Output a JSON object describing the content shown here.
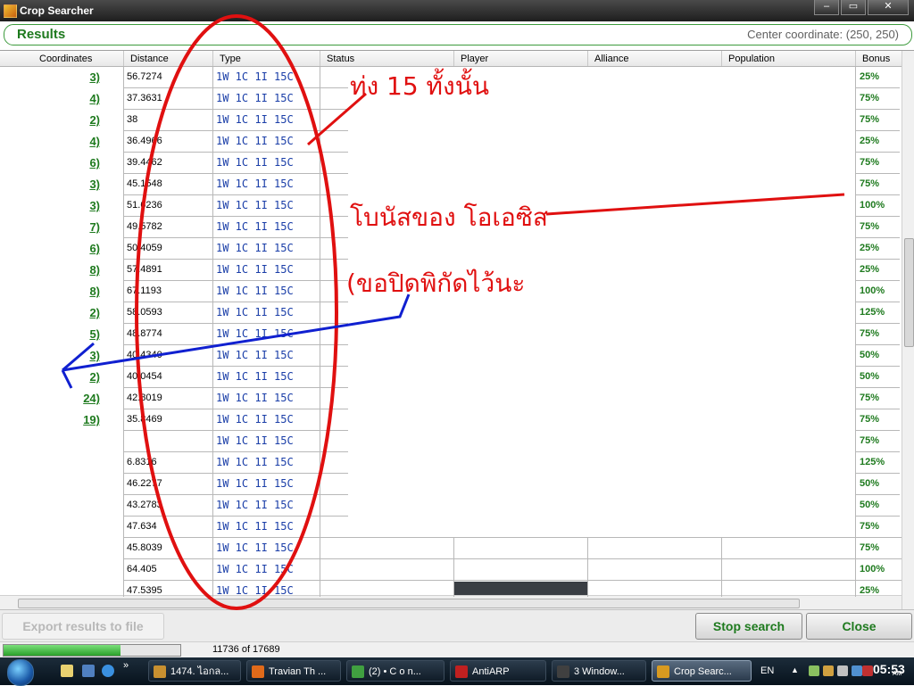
{
  "window": {
    "title": "Crop Searcher",
    "buttons": [
      "–",
      "▭",
      "✕"
    ]
  },
  "results": {
    "title": "Results",
    "center_coordinate": "Center coordinate: (250, 250)"
  },
  "grid": {
    "columns": [
      "Coordinates",
      "Distance",
      "Type",
      "Status",
      "Player",
      "Alliance",
      "Population",
      "Bonus"
    ],
    "rows": [
      {
        "coord": "3)",
        "distance": "56.7274",
        "type": "1W 1C 1I 15C",
        "bonus": "25%"
      },
      {
        "coord": "4)",
        "distance": "37.3631",
        "type": "1W 1C 1I 15C",
        "bonus": "75%"
      },
      {
        "coord": "2)",
        "distance": "38",
        "type": "1W 1C 1I 15C",
        "bonus": "75%"
      },
      {
        "coord": "4)",
        "distance": "36.4966",
        "type": "1W 1C 1I 15C",
        "bonus": "25%"
      },
      {
        "coord": "6)",
        "distance": "39.4462",
        "type": "1W 1C 1I 15C",
        "bonus": "75%"
      },
      {
        "coord": "3)",
        "distance": "45.1548",
        "type": "1W 1C 1I 15C",
        "bonus": "75%"
      },
      {
        "coord": "3)",
        "distance": "51.6236",
        "type": "1W 1C 1I 15C",
        "bonus": "100%"
      },
      {
        "coord": "7)",
        "distance": "49.5782",
        "type": "1W 1C 1I 15C",
        "bonus": "75%"
      },
      {
        "coord": "6)",
        "distance": "50.4059",
        "type": "1W 1C 1I 15C",
        "bonus": "25%"
      },
      {
        "coord": "8)",
        "distance": "57.4891",
        "type": "1W 1C 1I 15C",
        "bonus": "25%"
      },
      {
        "coord": "8)",
        "distance": "67.1193",
        "type": "1W 1C 1I 15C",
        "bonus": "100%"
      },
      {
        "coord": "2)",
        "distance": "58.0593",
        "type": "1W 1C 1I 15C",
        "bonus": "125%"
      },
      {
        "coord": "5)",
        "distance": "48.8774",
        "type": "1W 1C 1I 15C",
        "bonus": "75%"
      },
      {
        "coord": "3)",
        "distance": "40.4340",
        "type": "1W 1C 1I 15C",
        "bonus": "50%"
      },
      {
        "coord": "2)",
        "distance": "40.0454",
        "type": "1W 1C 1I 15C",
        "bonus": "50%"
      },
      {
        "coord": "24)",
        "distance": "42.8019",
        "type": "1W 1C 1I 15C",
        "bonus": "75%"
      },
      {
        "coord": "19)",
        "distance": "35.8469",
        "type": "1W 1C 1I 15C",
        "bonus": "75%"
      },
      {
        "coord": "",
        "distance": "",
        "type": "1W 1C 1I 15C",
        "bonus": "75%"
      },
      {
        "coord": "",
        "distance": "6.8316",
        "type": "1W 1C 1I 15C",
        "bonus": "125%"
      },
      {
        "coord": "",
        "distance": "46.2277",
        "type": "1W 1C 1I 15C",
        "bonus": "50%"
      },
      {
        "coord": "",
        "distance": "43.2783",
        "type": "1W 1C 1I 15C",
        "bonus": "50%"
      },
      {
        "coord": "",
        "distance": "47.634",
        "type": "1W 1C 1I 15C",
        "bonus": "75%"
      },
      {
        "coord": "",
        "distance": "45.8039",
        "type": "1W 1C 1I 15C",
        "bonus": "75%"
      },
      {
        "coord": "",
        "distance": "64.405",
        "type": "1W 1C 1I 15C",
        "bonus": "100%"
      },
      {
        "coord": "",
        "distance": "47.5395",
        "type": "1W 1C 1I 15C",
        "bonus": "25%"
      }
    ]
  },
  "buttons": {
    "export": "Export results to file",
    "stop": "Stop search",
    "close": "Close"
  },
  "progress": {
    "fraction": 0.6635,
    "label": "11736 of 17689"
  },
  "annotations": {
    "type_note": "ท่ง 15 ทั้งนั้น",
    "bonus_note": "โบนัสของ โอเอซิส",
    "coord_note": "(ขอปิดพิกัดไว้นะ"
  },
  "taskbar": {
    "items": [
      {
        "label": "1474. ไอกล...",
        "color": "#c89030"
      },
      {
        "label": "Travian Th ...",
        "color": "#e06a1a"
      },
      {
        "label": "(2) •   C o n...",
        "color": "#40a040"
      },
      {
        "label": "AntiARP",
        "color": "#c02020"
      },
      {
        "label": "3 Window...",
        "color": "#404040"
      },
      {
        "label": "Crop Searc...",
        "color": "#d89a20",
        "active": true
      }
    ],
    "lang": "EN",
    "time": "05:53",
    "ampm": "AM"
  },
  "colors": {
    "accent": "#1e7a1e",
    "type_text": "#1a3ea8",
    "annotation_red": "#e01010",
    "annotation_blue": "#1020d0"
  }
}
